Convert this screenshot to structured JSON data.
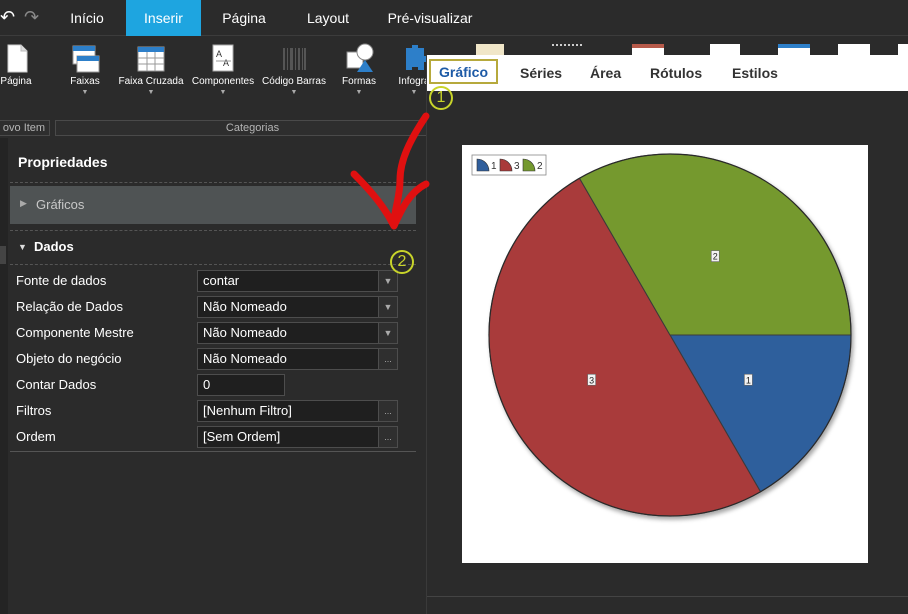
{
  "menubar": {
    "tabs": [
      "Início",
      "Inserir",
      "Página",
      "Layout",
      "Pré-visualizar"
    ],
    "active_tab": "Inserir"
  },
  "ribbon": {
    "items": [
      {
        "label": "Página",
        "icon": "page-icon"
      },
      {
        "label": "Faixas",
        "icon": "bands-icon"
      },
      {
        "label": "Faixa Cruzada",
        "icon": "cross-band-icon"
      },
      {
        "label": "Componentes",
        "icon": "components-icon"
      },
      {
        "label": "Código Barras",
        "icon": "barcode-icon"
      },
      {
        "label": "Formas",
        "icon": "shapes-icon"
      },
      {
        "label": "Infogra",
        "icon": "infographic-icon"
      }
    ],
    "groups": [
      "ovo Item",
      "Categorias"
    ]
  },
  "properties": {
    "title": "Propriedades",
    "section_graficos": "Gráficos",
    "section_dados": "Dados",
    "rows": [
      {
        "label": "Fonte de dados",
        "value": "contar"
      },
      {
        "label": "Relação de Dados",
        "value": "Não Nomeado"
      },
      {
        "label": "Componente Mestre",
        "value": "Não Nomeado"
      },
      {
        "label": "Objeto do negócio",
        "value": "Não Nomeado"
      },
      {
        "label": "Contar Dados",
        "value": "0"
      },
      {
        "label": "Filtros",
        "value": "[Nenhum Filtro]"
      },
      {
        "label": "Ordem",
        "value": "[Sem Ordem]"
      }
    ],
    "dropdown_glyph": "▼",
    "ellipsis_glyph": "..."
  },
  "editor": {
    "tabs": [
      "Gráfico",
      "Séries",
      "Área",
      "Rótulos",
      "Estilos"
    ],
    "active_tab": "Gráfico"
  },
  "annotations": {
    "step1": "1",
    "step2": "2"
  },
  "colors": {
    "accent_tab": "#1ea5e0",
    "arrow": "#e01010",
    "badge": "#c8d42a",
    "slice1": "#2f5e9c",
    "slice2": "#74992f",
    "slice3": "#a93a3a"
  },
  "chart_data": {
    "type": "pie",
    "categories": [
      "1",
      "2",
      "3"
    ],
    "values": [
      1,
      2,
      3
    ],
    "legend": [
      "1",
      "3",
      "2"
    ],
    "data_labels": [
      "1",
      "2",
      "3"
    ],
    "legend_position": "top-left"
  }
}
